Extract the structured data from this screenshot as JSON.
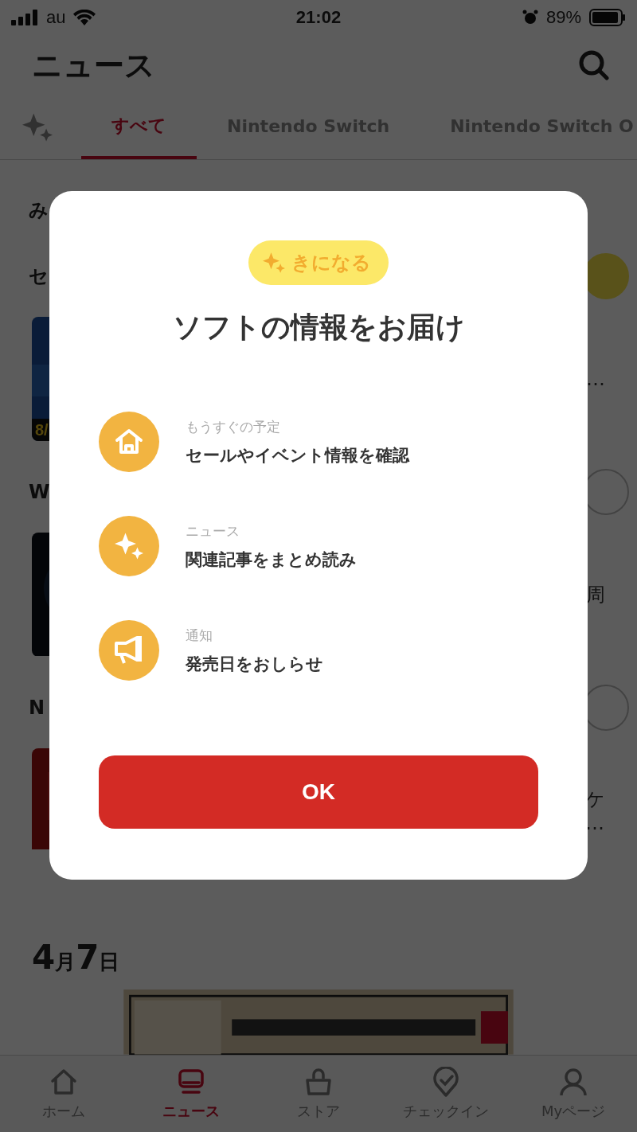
{
  "status_bar": {
    "carrier": "au",
    "time": "21:02",
    "battery": "89%"
  },
  "header": {
    "title": "ニュース"
  },
  "tabs": [
    {
      "label": "すべて",
      "selected": true
    },
    {
      "label": "Nintendo Switch",
      "selected": false
    },
    {
      "label": "Nintendo Switch O",
      "selected": false
    }
  ],
  "sections": [
    {
      "heading": "み"
    },
    {
      "heading": "セ",
      "following": true,
      "card": {
        "badge": "8/",
        "side_text": [
          "…"
        ]
      }
    },
    {
      "heading": "W",
      "following": false,
      "card": {
        "side_text": [
          "周"
        ]
      }
    },
    {
      "heading": "N",
      "following": false,
      "card": {
        "side_text": [
          "ケ",
          "…"
        ]
      }
    }
  ],
  "date_heading": [
    "4",
    "月",
    "7",
    "日"
  ],
  "bottom_nav": [
    {
      "kind": "home",
      "label": "ホーム",
      "selected": false
    },
    {
      "kind": "news",
      "label": "ニュース",
      "selected": true
    },
    {
      "kind": "store",
      "label": "ストア",
      "selected": false
    },
    {
      "kind": "checkin",
      "label": "チェックイン",
      "selected": false
    },
    {
      "kind": "mypage",
      "label": "Myページ",
      "selected": false
    }
  ],
  "dialog": {
    "badge": "きになる",
    "title": "ソフトの情報をお届け",
    "features": [
      {
        "kind": "home",
        "caption": "もうすぐの予定",
        "text": "セールやイベント情報を確認"
      },
      {
        "kind": "sparkle",
        "caption": "ニュース",
        "text": "関連記事をまとめ読み"
      },
      {
        "kind": "megaphone",
        "caption": "通知",
        "text": "発売日をおしらせ"
      }
    ],
    "button": "OK"
  }
}
